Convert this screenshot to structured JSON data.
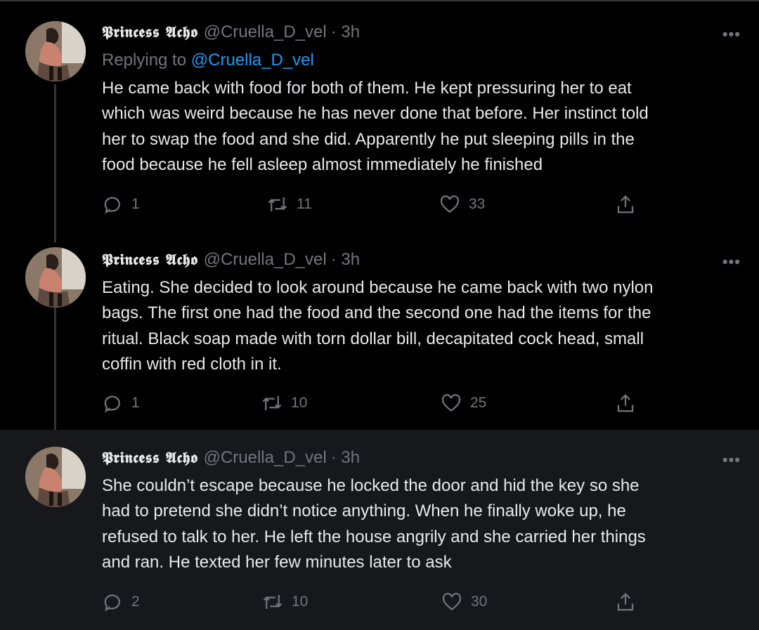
{
  "tweets": [
    {
      "name": "𝕻𝖗𝖎𝖓𝖈𝖊𝖘𝖘 𝕬𝖈𝖍𝖔",
      "handle": "@Cruella_D_vel",
      "time": "· 3h",
      "replying_prefix": "Replying to",
      "replying_to": "@Cruella_D_vel",
      "text": "He came back with food for both of them. He kept pressuring her to eat\nwhich was weird because he has never done that before. Her instinct told\nher to swap the food and she did. Apparently he put sleeping pills in the\nfood because he fell asleep almost immediately he finished",
      "replies": "1",
      "retweets": "11",
      "likes": "33",
      "more": "•••"
    },
    {
      "name": "𝕻𝖗𝖎𝖓𝖈𝖊𝖘𝖘 𝕬𝖈𝖍𝖔",
      "handle": "@Cruella_D_vel",
      "time": "· 3h",
      "text": "Eating. She decided to look around because he came back with two nylon\nbags. The first one had the food and the second one had the items for the\nritual. Black soap made with torn dollar bill, decapitated cock head, small\ncoffin with red cloth in it.",
      "replies": "1",
      "retweets": "10",
      "likes": "25",
      "more": "•••"
    },
    {
      "name": "𝕻𝖗𝖎𝖓𝖈𝖊𝖘𝖘 𝕬𝖈𝖍𝖔",
      "handle": "@Cruella_D_vel",
      "time": "· 3h",
      "text": "She couldn’t escape because he locked the door and hid the key so she\nhad to pretend she didn’t notice anything. When he finally woke up, he\nrefused to talk to her. He left the house angrily and she carried her things\nand ran. He texted her few minutes later to ask",
      "replies": "2",
      "retweets": "10",
      "likes": "30",
      "more": "•••"
    }
  ],
  "colors": {
    "background": "#000000",
    "highlight_background": "#16181c",
    "text": "#e7e9ea",
    "muted": "#71767b",
    "link": "#1d9bf0"
  }
}
